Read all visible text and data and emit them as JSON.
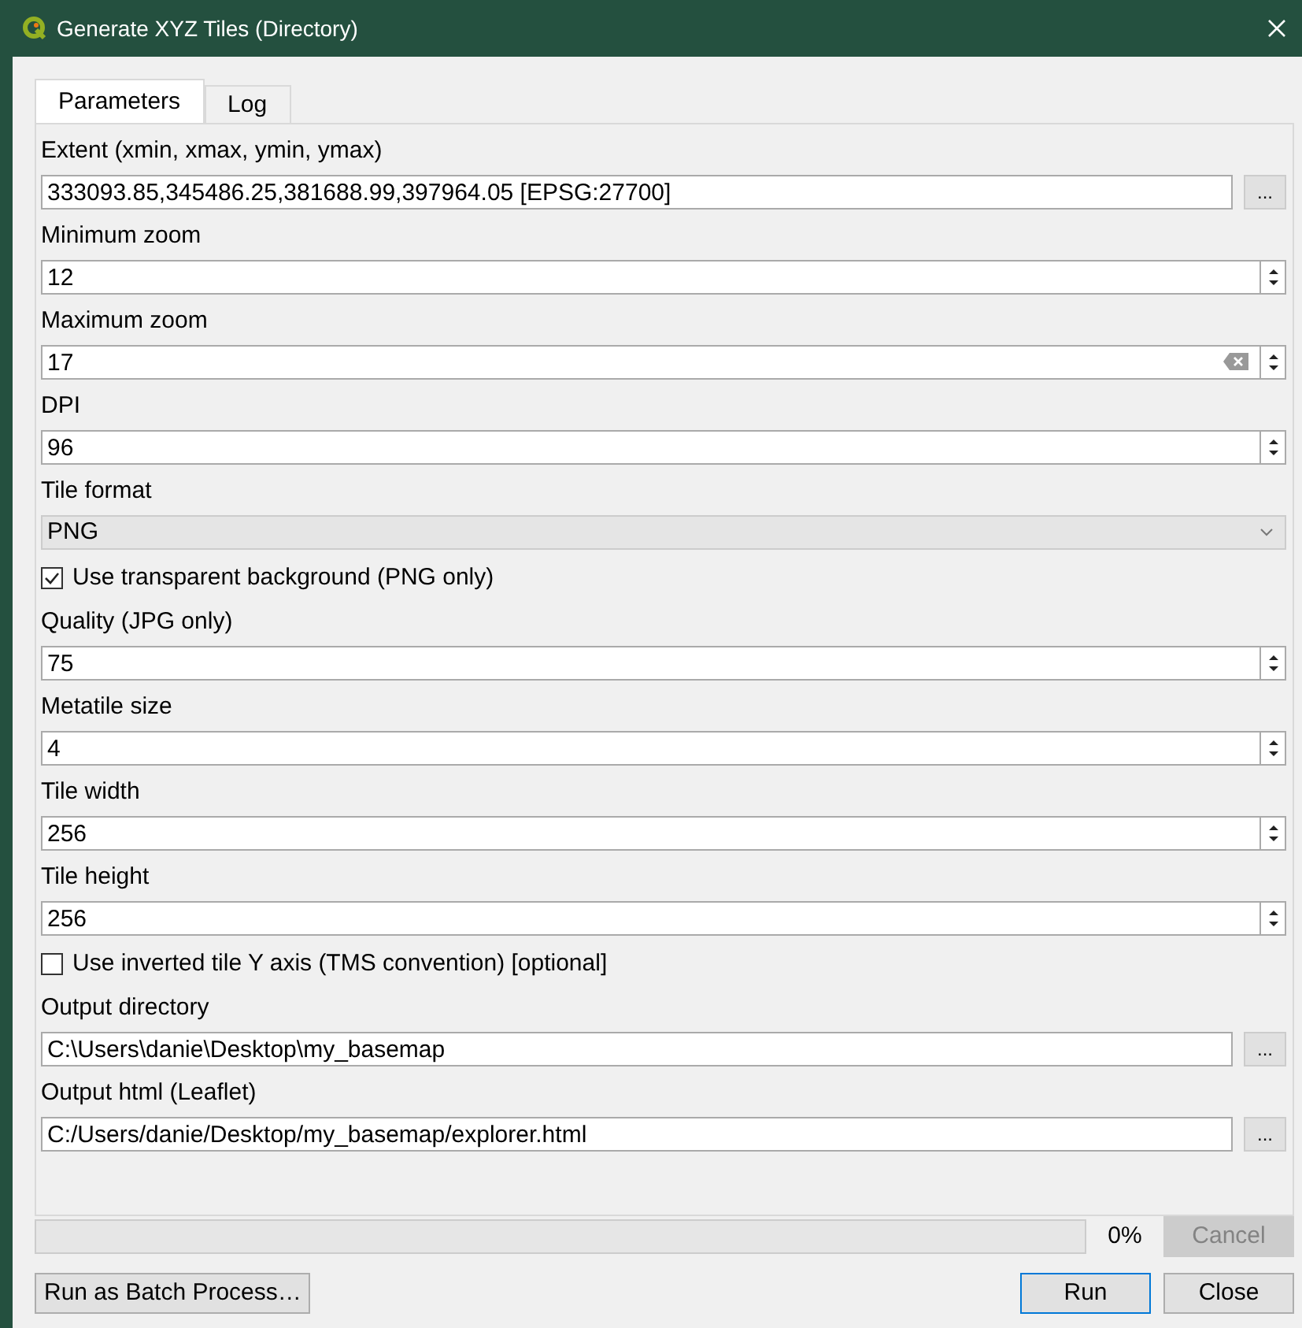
{
  "window": {
    "title": "Generate XYZ Tiles (Directory)"
  },
  "tabs": [
    {
      "label": "Parameters",
      "selected": true
    },
    {
      "label": "Log",
      "selected": false
    }
  ],
  "parameters": [
    {
      "kind": "browse",
      "label": "Extent (xmin, xmax, ymin, ymax)",
      "value": "333093.85,345486.25,381688.99,397964.05 [EPSG:27700]",
      "button": "..."
    },
    {
      "kind": "spin",
      "label": "Minimum zoom",
      "value": "12",
      "clearable": false
    },
    {
      "kind": "spin",
      "label": "Maximum zoom",
      "value": "17",
      "clearable": true
    },
    {
      "kind": "spin",
      "label": "DPI",
      "value": "96",
      "clearable": false
    },
    {
      "kind": "combo",
      "label": "Tile format",
      "value": "PNG"
    },
    {
      "kind": "checkbox",
      "label": "Use transparent background (PNG only)",
      "checked": true
    },
    {
      "kind": "spin",
      "label": "Quality (JPG only)",
      "value": "75",
      "clearable": false
    },
    {
      "kind": "spin",
      "label": "Metatile size",
      "value": "4",
      "clearable": false
    },
    {
      "kind": "spin",
      "label": "Tile width",
      "value": "256",
      "clearable": false
    },
    {
      "kind": "spin",
      "label": "Tile height",
      "value": "256",
      "clearable": false
    },
    {
      "kind": "checkbox",
      "label": "Use inverted tile Y axis (TMS convention) [optional]",
      "checked": false
    },
    {
      "kind": "browse",
      "label": "Output directory",
      "value": "C:\\Users\\danie\\Desktop\\my_basemap",
      "button": "..."
    },
    {
      "kind": "browse",
      "label": "Output html (Leaflet)",
      "value": "C:/Users/danie/Desktop/my_basemap/explorer.html",
      "button": "..."
    }
  ],
  "progress": {
    "level": 0,
    "reading": "0%"
  },
  "buttons": [
    {
      "label": "Cancel",
      "disabled": true
    },
    {
      "label": "Run as Batch Process…",
      "disabled": false
    },
    {
      "label": "Run",
      "disabled": false,
      "default": true
    },
    {
      "label": "Close",
      "disabled": false
    }
  ]
}
